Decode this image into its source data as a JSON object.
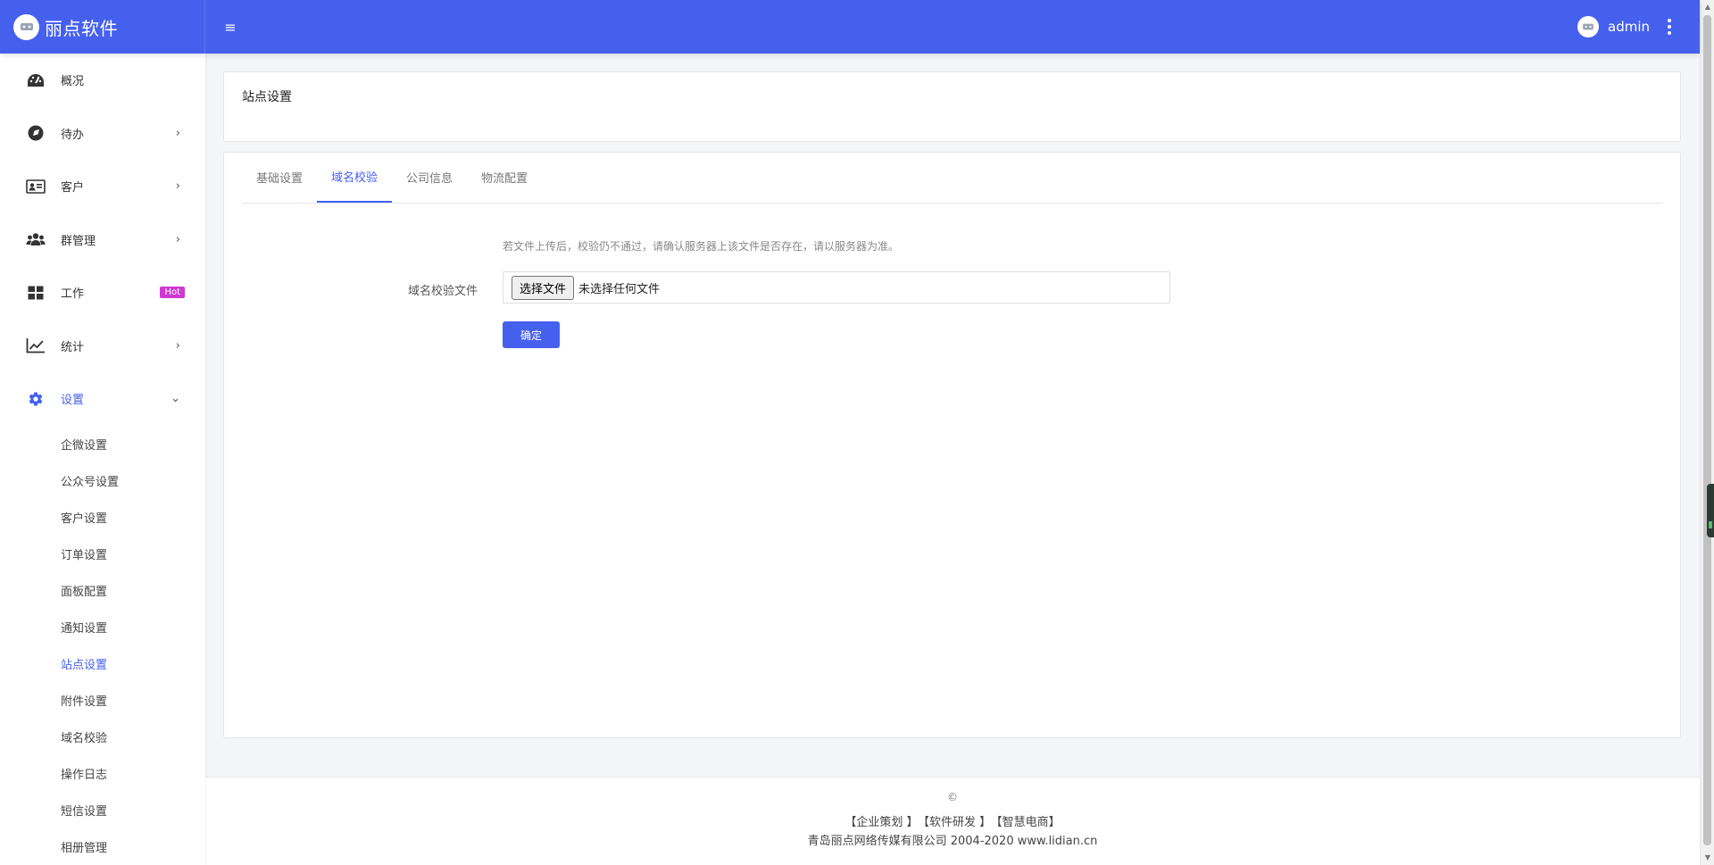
{
  "header": {
    "brand_name": "丽点软件",
    "menu_toggle": "≡",
    "username": "admin"
  },
  "sidebar": {
    "items": [
      {
        "label": "概况",
        "icon": "dashboard-icon"
      },
      {
        "label": "待办",
        "icon": "compass-icon",
        "arrow": "›"
      },
      {
        "label": "客户",
        "icon": "id-card-icon",
        "arrow": "›"
      },
      {
        "label": "群管理",
        "icon": "users-icon",
        "arrow": "›"
      },
      {
        "label": "工作",
        "icon": "grid-icon",
        "badge": "Hot"
      },
      {
        "label": "统计",
        "icon": "chart-line-icon",
        "arrow": "›"
      },
      {
        "label": "设置",
        "icon": "gear-icon",
        "arrow": "⌄"
      }
    ],
    "sub_items": [
      "企微设置",
      "公众号设置",
      "客户设置",
      "订单设置",
      "面板配置",
      "通知设置",
      "站点设置",
      "附件设置",
      "域名校验",
      "操作日志",
      "短信设置",
      "相册管理"
    ]
  },
  "page": {
    "title": "站点设置",
    "tabs": [
      "基础设置",
      "域名校验",
      "公司信息",
      "物流配置"
    ],
    "active_tab": "域名校验",
    "hint": "若文件上传后，校验仍不通过，请确认服务器上该文件是否存在，请以服务器为准。",
    "form_label": "域名校验文件",
    "file_button": "选择文件",
    "file_status": "未选择任何文件",
    "submit_label": "确定"
  },
  "footer": {
    "copyright": "©",
    "links": [
      "【企业策划 】",
      "【软件研发 】",
      "【智慧电商】"
    ],
    "company": "青岛丽点网络传媒有限公司 2004-2020 www.lidian.cn"
  },
  "colors": {
    "primary": "#4660ee",
    "hot_badge": "#cd39d1"
  }
}
